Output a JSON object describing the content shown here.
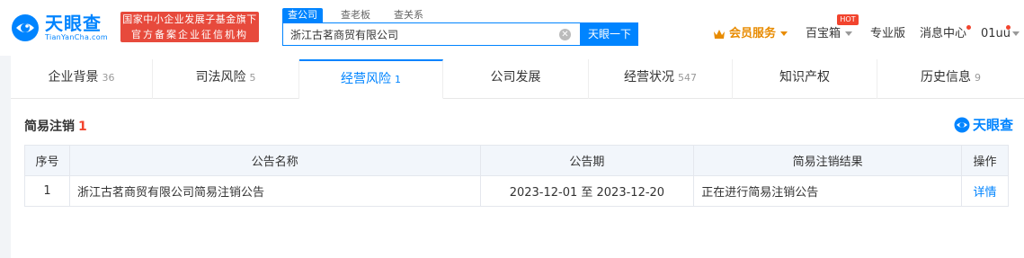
{
  "header": {
    "logo_cn": "天眼查",
    "logo_en": "TianYanCha.com",
    "badge_line1": "国家中小企业发展子基金旗下",
    "badge_line2": "官方备案企业征信机构",
    "search_tabs": [
      "查公司",
      "查老板",
      "查关系"
    ],
    "search_value": "浙江古茗商贸有限公司",
    "search_button": "天眼一下",
    "vip_label": "会员服务",
    "treasure_label": "百宝箱",
    "hot_label": "HOT",
    "pro_label": "专业版",
    "message_label": "消息中心",
    "user_label": "01uu"
  },
  "nav_tabs": [
    {
      "label": "企业背景",
      "count": "36"
    },
    {
      "label": "司法风险",
      "count": "5"
    },
    {
      "label": "经营风险",
      "count": "1"
    },
    {
      "label": "公司发展",
      "count": ""
    },
    {
      "label": "经营状况",
      "count": "547"
    },
    {
      "label": "知识产权",
      "count": ""
    },
    {
      "label": "历史信息",
      "count": "9"
    }
  ],
  "section": {
    "title": "简易注销",
    "count": "1",
    "watermark": "天眼查"
  },
  "table": {
    "headers": [
      "序号",
      "公告名称",
      "公告期",
      "简易注销结果",
      "操作"
    ],
    "rows": [
      [
        "1",
        "浙江古茗商贸有限公司简易注销公告",
        "2023-12-01 至 2023-12-20",
        "正在进行简易注销公告",
        "详情"
      ]
    ]
  },
  "colors": {
    "brand_blue": "#0084ff",
    "badge_red": "#e74a3c",
    "vip_orange": "#e88b00"
  }
}
